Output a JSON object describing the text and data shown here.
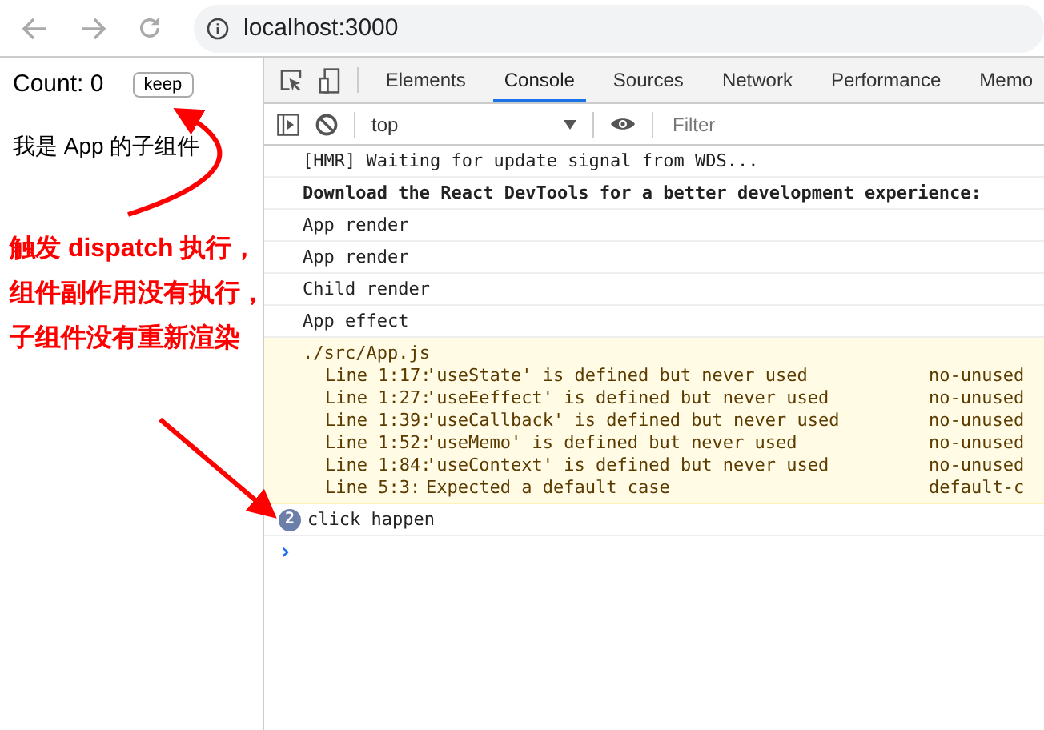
{
  "browser": {
    "url": "localhost:3000"
  },
  "page": {
    "count_label": "Count: 0",
    "button": "keep",
    "child_text": "我是 App 的子组件"
  },
  "devtools": {
    "tabs": [
      {
        "label": "Elements",
        "selected": false
      },
      {
        "label": "Console",
        "selected": true
      },
      {
        "label": "Sources",
        "selected": false
      },
      {
        "label": "Network",
        "selected": false
      },
      {
        "label": "Performance",
        "selected": false
      },
      {
        "label": "Memo",
        "selected": false
      }
    ],
    "context": "top",
    "filter": {
      "placeholder": "Filter"
    },
    "messages": [
      {
        "kind": "log",
        "text": "[HMR] Waiting for update signal from WDS..."
      },
      {
        "kind": "bold",
        "text": "Download the React DevTools for a better development experience:"
      },
      {
        "kind": "log",
        "text": "App render"
      },
      {
        "kind": "log",
        "text": "App render"
      },
      {
        "kind": "log",
        "text": "Child render"
      },
      {
        "kind": "log",
        "text": "App effect"
      },
      {
        "kind": "warning",
        "text": "./src/App.js",
        "lines": [
          {
            "location": "Line 1:17:",
            "message": "'useState' is defined but never used",
            "rule": "no-unused"
          },
          {
            "location": "Line 1:27:",
            "message": "'useEeffect' is defined but never used",
            "rule": "no-unused"
          },
          {
            "location": "Line 1:39:",
            "message": "'useCallback' is defined but never used",
            "rule": "no-unused"
          },
          {
            "location": "Line 1:52:",
            "message": "'useMemo' is defined but never used",
            "rule": "no-unused"
          },
          {
            "location": "Line 1:84:",
            "message": "'useContext' is defined but never used",
            "rule": "no-unused"
          },
          {
            "location": "Line 5:3:",
            "message": "Expected a default case",
            "rule": "default-c"
          }
        ]
      },
      {
        "kind": "repeat",
        "count": "2",
        "text": "click happen"
      }
    ],
    "prompt": "›"
  },
  "annotation": {
    "lines": [
      "触发 dispatch 执行，",
      "组件副作用没有执行，",
      "子组件没有重新渲染"
    ]
  }
}
